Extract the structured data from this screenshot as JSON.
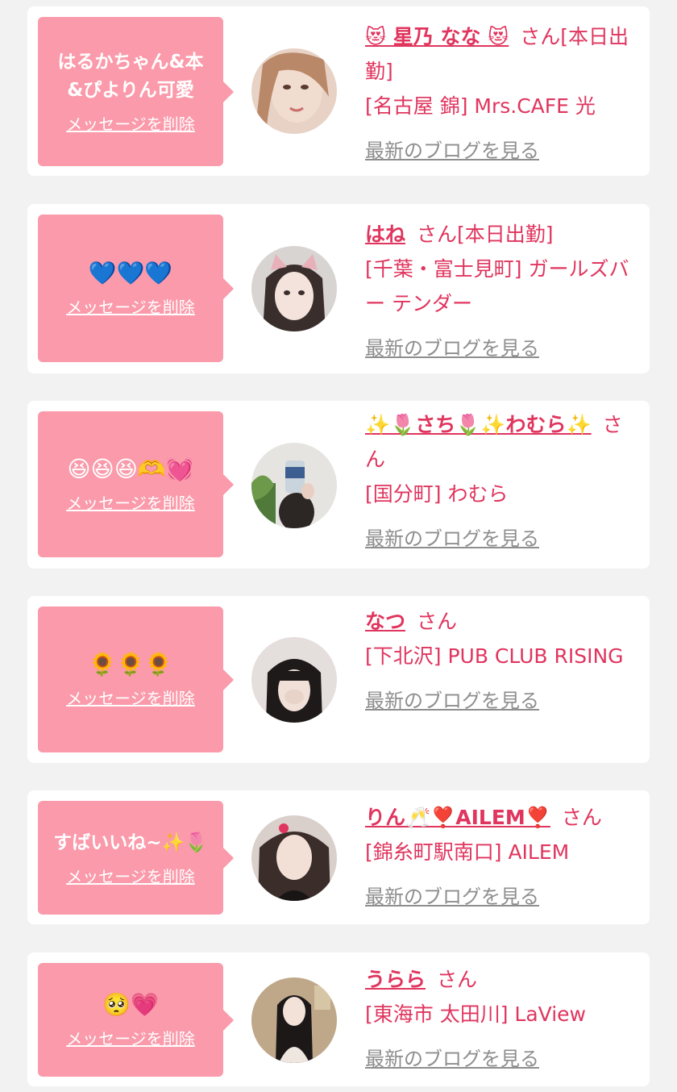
{
  "delete_label": "メッセージを削除",
  "blog_label": "最新のブログを見る",
  "san_label": "さん",
  "accent_color": "#e0355e",
  "bubble_color": "#fa9aaa",
  "items": [
    {
      "message": "はるかちゃん&本\n&ぴよりん可愛",
      "name": "😻 星乃 なな 😻",
      "suffix": "[本日出勤]",
      "shop": "[名古屋 錦] Mrs.CAFE 光"
    },
    {
      "message": "💙💙💙",
      "name": "はね",
      "suffix": "[本日出勤]",
      "shop": "[千葉・富士見町] ガールズバー テンダー"
    },
    {
      "message": "😆😆😆🫶💓",
      "name": "✨🌷さち🌷✨わむら✨",
      "suffix": "",
      "shop": "[国分町] わむら"
    },
    {
      "message": "🌻🌻🌻",
      "name": "なつ",
      "suffix": "",
      "shop": "[下北沢] PUB CLUB RISING"
    },
    {
      "message": "すばいいね~✨🌷",
      "name": "りん🥂❣️AILEM❣️",
      "suffix": "",
      "shop": "[錦糸町駅南口] AILEM"
    },
    {
      "message": "🥺💗",
      "name": "うらら",
      "suffix": "",
      "shop": "[東海市 太田川] LaView"
    }
  ]
}
